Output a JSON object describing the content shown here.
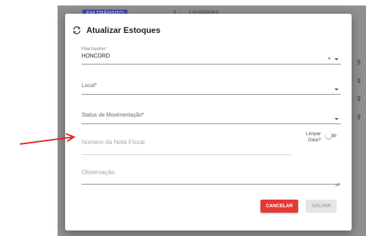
{
  "background": {
    "chip": "EM TRÂNSITO",
    "header_text": "Localidades",
    "header_marks": "⊻ ⌄",
    "side_marks": [
      "g",
      "g",
      "g",
      "g"
    ]
  },
  "dialog": {
    "title": "Atualizar Estoques",
    "title_icon": "sync-icon",
    "fields": {
      "filial": {
        "label": "Filial Destino*",
        "value": "HONCORD",
        "clear": "×"
      },
      "local": {
        "label": "Local*"
      },
      "status": {
        "label": "Status de Movimentação*"
      },
      "nota": {
        "placeholder": "Número da Nota Fiscal"
      },
      "observacao": {
        "placeholder": "Observação"
      }
    },
    "toggle": {
      "label_line1": "Limpar",
      "label_line2": "Data?",
      "checked": false
    },
    "buttons": {
      "cancel": "CANCELAR",
      "save": "SALVAR"
    }
  },
  "colors": {
    "accent_red": "#e53935",
    "annotation_arrow": "#e02020"
  }
}
